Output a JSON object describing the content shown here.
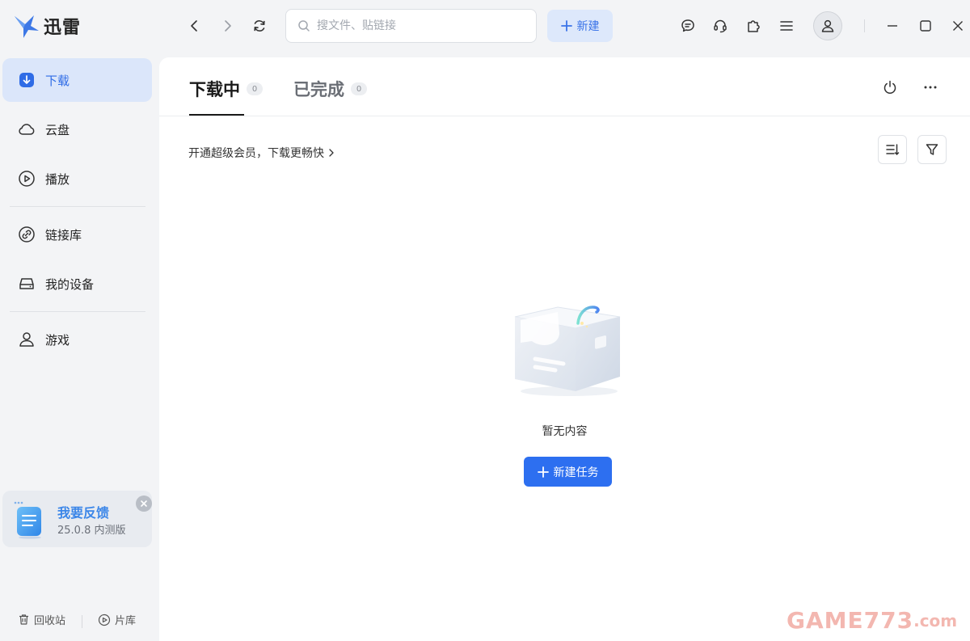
{
  "app": {
    "name": "迅雷",
    "accent_color": "#2d6ff0"
  },
  "toolbar": {
    "search_placeholder": "搜文件、贴链接",
    "new_label": "新建",
    "icons": [
      "back-icon",
      "forward-icon",
      "refresh-icon",
      "message-icon",
      "headset-icon",
      "puzzle-icon",
      "menu-icon",
      "user-icon",
      "minimize-icon",
      "maximize-icon",
      "close-icon"
    ]
  },
  "sidebar": {
    "items": [
      {
        "label": "下载",
        "icon": "download-icon",
        "active": true
      },
      {
        "label": "云盘",
        "icon": "cloud-icon",
        "active": false
      },
      {
        "label": "播放",
        "icon": "play-icon",
        "active": false
      },
      {
        "label": "链接库",
        "icon": "link-icon",
        "active": false
      },
      {
        "label": "我的设备",
        "icon": "device-icon",
        "active": false
      },
      {
        "label": "游戏",
        "icon": "game-icon",
        "active": false
      }
    ],
    "feedback": {
      "title": "我要反馈",
      "version": "25.0.8 内测版"
    },
    "bottom": {
      "recycle_label": "回收站",
      "library_label": "片库"
    }
  },
  "main": {
    "tabs": [
      {
        "label": "下载中",
        "count": "0",
        "active": true
      },
      {
        "label": "已完成",
        "count": "0",
        "active": false
      }
    ],
    "promo_text": "开通超级会员，下载更畅快",
    "empty_text": "暂无内容",
    "create_task_label": "新建任务"
  },
  "watermark": {
    "main": "GAME773",
    "sub": ".com"
  }
}
